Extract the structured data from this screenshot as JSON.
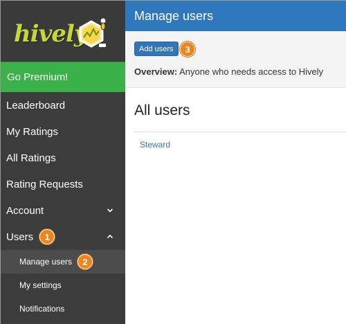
{
  "sidebar": {
    "logo_text": "hively",
    "premium_label": "Go Premium!",
    "items": [
      {
        "label": "Leaderboard"
      },
      {
        "label": "My Ratings"
      },
      {
        "label": "All Ratings"
      },
      {
        "label": "Rating Requests"
      },
      {
        "label": "Account",
        "icon": "chevron-down-icon"
      },
      {
        "label": "Users",
        "icon": "chevron-up-icon",
        "badge": "1"
      }
    ],
    "subitems": [
      {
        "label": "Manage users",
        "active": true,
        "badge": "2"
      },
      {
        "label": "My settings"
      },
      {
        "label": "Notifications"
      }
    ]
  },
  "header": {
    "title": "Manage users"
  },
  "toolbar": {
    "add_button_label": "Add users",
    "badge": "3",
    "overview_label": "Overview:",
    "overview_text": "Anyone who needs access to Hively"
  },
  "main": {
    "section_title": "All users",
    "users": [
      "Steward"
    ]
  },
  "colors": {
    "sidebar_bg": "#3c3c3c",
    "premium_green": "#3bb149",
    "header_blue": "#2f78be",
    "badge_orange": "#f0831c",
    "link_blue": "#3673b5"
  }
}
